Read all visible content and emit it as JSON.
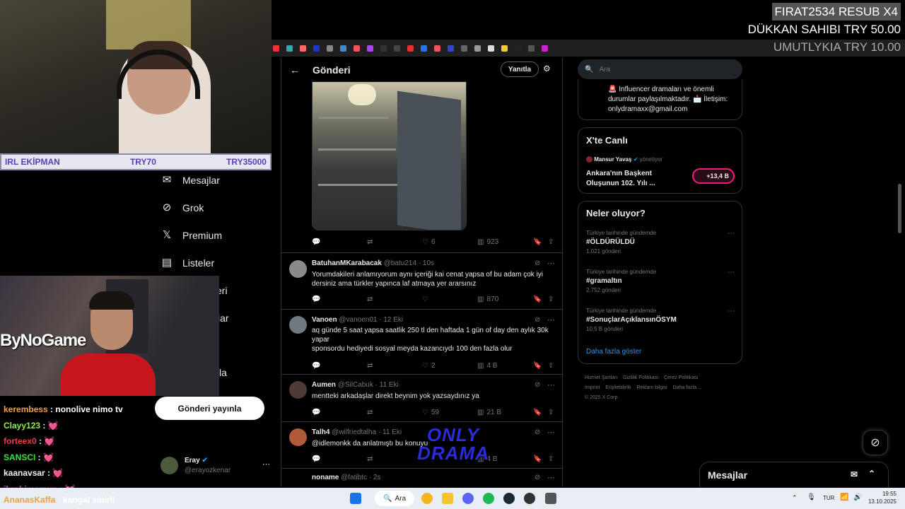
{
  "stream_overlay": {
    "irl_label": "IRL EKİPMAN",
    "irl_price1": "TRY70",
    "irl_price2": "TRY35000",
    "donation1": "FIRAT2534  RESUB X4",
    "donation2": "DÜKKAN SAHIBI  TRY 50.00",
    "donation3": "UMUTLYKIA  TRY 10.00",
    "sponsor": "ByNoGame",
    "chat": [
      {
        "user": "kerembess",
        "color": "#f0a040",
        "message": "nonolive nimo tv"
      },
      {
        "user": "Clayy123",
        "color": "#8cf04a",
        "message": "💓"
      },
      {
        "user": "forteex0",
        "color": "#e94040",
        "message": "💓"
      },
      {
        "user": "SANSCI",
        "color": "#3ce03c",
        "message": "💓"
      },
      {
        "user": "kaanavsar",
        "color": "#f0f0f0",
        "message": "💓"
      },
      {
        "user": "ibrahimarmm",
        "color": "#d040d0",
        "message": "💓"
      },
      {
        "user": "AnanasKaffa",
        "color": "#f0a040",
        "message": "kangal sinirli"
      }
    ]
  },
  "nav": {
    "items": [
      {
        "label": "Mesajlar",
        "icon": "mail-icon"
      },
      {
        "label": "Grok",
        "icon": "grok-icon"
      },
      {
        "label": "Premium",
        "icon": "x-icon"
      },
      {
        "label": "Listeler",
        "icon": "list-icon"
      },
      {
        "label": "tleri",
        "icon": ""
      },
      {
        "label": "lar",
        "icon": ""
      },
      {
        "label": "la",
        "icon": ""
      }
    ],
    "post_button": "Gönderi yayınla",
    "account_name": "Eray",
    "account_handle": "@erayozkenar",
    "account_more": "⋯"
  },
  "feed": {
    "title": "Gönderi",
    "reply_button": "Yanıtla",
    "first_post_stats": {
      "likes": "6",
      "views": "923"
    },
    "tweets": [
      {
        "name": "BatuhanMKarabacak",
        "handle": "@batu214",
        "time": "10s",
        "text": "Yorumdakileri anlamıyorum aynı içeriği kai cenat yapsa of bu adam çok iyi dersiniz ama türkler yapınca laf atmaya yer ararsınız",
        "replies": "",
        "reposts": "",
        "likes": "",
        "views": "870"
      },
      {
        "name": "Vanoen",
        "handle": "@vanoen01",
        "time": "12 Eki",
        "text": "aq günde 5 saat yapsa saatlik 250 tl den haftada 1 gün of day den aylık 30k yapar\nsponsordu hediyedi sosyal meyda kazancıydı  100 den fazla olur",
        "replies": "",
        "reposts": "",
        "likes": "2",
        "views": "4 B"
      },
      {
        "name": "Aumen",
        "handle": "@SilCabuk",
        "time": "11 Eki",
        "text": "mentteki arkadaşlar direkt beynim yok yazsaydınız ya",
        "replies": "",
        "reposts": "",
        "likes": "59",
        "views": "21 B"
      },
      {
        "name": "Talh4",
        "handle": "@wilfriedtalha",
        "time": "11 Eki",
        "text": "@idlemonkk da anlatmıştı bu konuyu",
        "replies": "",
        "reposts": "",
        "likes": "",
        "views": "4 B"
      },
      {
        "name": "noname",
        "handle": "@fatibtc",
        "time": "2s",
        "text": "",
        "replies": "",
        "reposts": "",
        "likes": "",
        "views": ""
      }
    ],
    "watermark": "ONLY DRAMA"
  },
  "right": {
    "search_placeholder": "Ara",
    "bio_text": "🚨 Influencer dramaları ve önemli durumlar paylaşılmaktadır. 📩 İletişim: onlydramaxx@gmail.com",
    "live_title": "X'te Canlı",
    "live_host": "Mansur Yavaş",
    "live_role": "yönetiyor",
    "live_text": "Ankara'nın Başkent Oluşunun 102. Yılı ...",
    "live_count": "+13,4 B",
    "trends_title": "Neler oluyor?",
    "trends": [
      {
        "context": "Türkiye tarihinde gündemde",
        "tag": "#ÖLDÜRÜLDÜ",
        "count": "1.021 gönderi"
      },
      {
        "context": "Türkiye tarihinde gündemde",
        "tag": "#gramaltın",
        "count": "2.752 gönderi"
      },
      {
        "context": "Türkiye tarihinde gündemde",
        "tag": "#SonuçlarAçıklansınÖSYM",
        "count": "10,5 B gönderi"
      }
    ],
    "show_more": "Daha fazla göster",
    "footer": [
      "Hizmet Şartları",
      "Gizlilik Politikası",
      "Çerez Politikası",
      "Imprint",
      "Erişilebilirlik",
      "Reklam bilgisi",
      "Daha fazla ...",
      "© 2025 X Corp."
    ],
    "messages_bar": "Mesajlar"
  },
  "taskbar": {
    "search": "Ara",
    "lang": "TUR",
    "time": "19:55",
    "date": "13.10.2025"
  },
  "colors": {
    "accent": "#1d9bf0",
    "bg": "#000000",
    "border": "#2f3336",
    "muted": "#71767b"
  }
}
